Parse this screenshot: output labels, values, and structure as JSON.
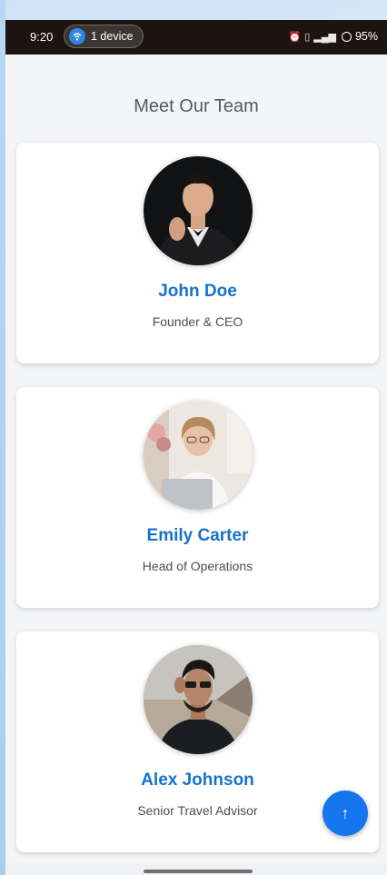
{
  "status_bar": {
    "time": "9:20",
    "hotspot_label": "1 device",
    "right_icons": [
      "alarm-icon",
      "volte-icon",
      "signal-icon"
    ],
    "battery": "95%"
  },
  "page": {
    "title": "Meet Our Team"
  },
  "team": [
    {
      "name": "John Doe",
      "role": "Founder & CEO"
    },
    {
      "name": "Emily Carter",
      "role": "Head of Operations"
    },
    {
      "name": "Alex Johnson",
      "role": "Senior Travel Advisor"
    }
  ],
  "scroll_top": {
    "icon": "↑"
  },
  "colors": {
    "accent": "#1672cc",
    "fab": "#1476ee",
    "status_bar_bg": "#1d1410",
    "background": "#f4f5f7"
  }
}
